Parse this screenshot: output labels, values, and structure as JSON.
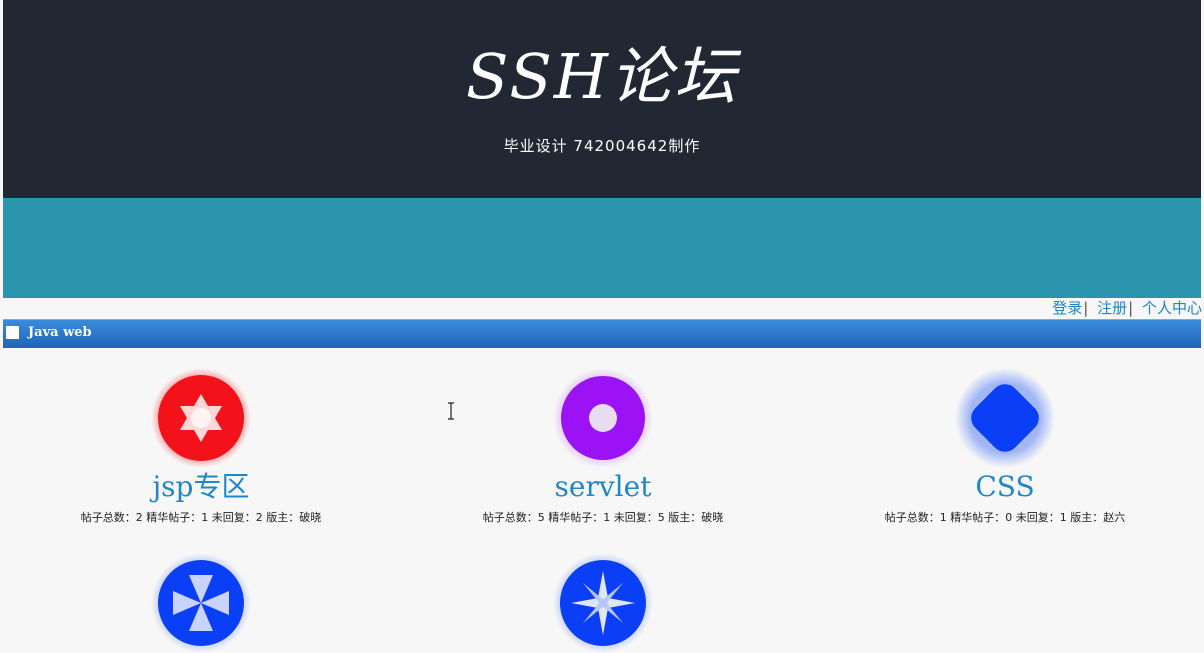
{
  "header": {
    "site_title": "SSH论坛",
    "subtitle": "毕业设计 742004642制作"
  },
  "user_nav": {
    "login": "登录",
    "register": "注册",
    "profile": "个人中心",
    "separator": "|"
  },
  "section": {
    "title": "Java web"
  },
  "boards": [
    {
      "name": "jsp专区",
      "stats": "帖子总数：2 精华帖子：1 未回复：2 版主：破晓",
      "icon": "red-star-icon",
      "color": "#f3121a"
    },
    {
      "name": "servlet",
      "stats": "帖子总数：5 精华帖子：1 未回复：5 版主：破晓",
      "icon": "purple-ring-icon",
      "color": "#9b12f4"
    },
    {
      "name": "CSS",
      "stats": "帖子总数：1 精华帖子：0 未回复：1 版主：赵六",
      "icon": "blue-diamond-icon",
      "color": "#0a3ff5"
    },
    {
      "name": "",
      "stats": "",
      "icon": "blue-propeller-icon",
      "color": "#0a3ff5"
    },
    {
      "name": "",
      "stats": "",
      "icon": "blue-sparkle-icon",
      "color": "#0a3ff5"
    }
  ]
}
